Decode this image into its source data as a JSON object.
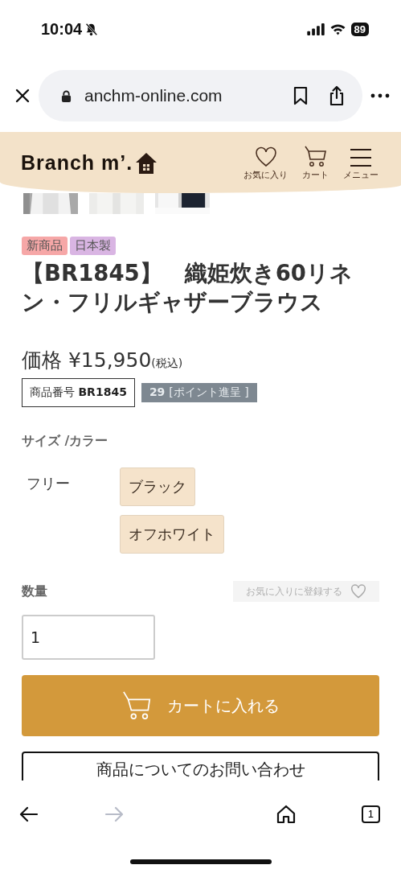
{
  "status_bar": {
    "time": "10:04",
    "battery": "89"
  },
  "browser": {
    "url": "anchm-online.com",
    "back_disabled": false,
    "forward_disabled": true,
    "tab_count": "1"
  },
  "site_header": {
    "logo": "Branch m’.",
    "nav": [
      {
        "kind": "heart",
        "label": "お気に入り"
      },
      {
        "kind": "cart",
        "label": "カート"
      },
      {
        "kind": "menu",
        "label": "メニュー"
      }
    ]
  },
  "product": {
    "tags": [
      {
        "label": "新商品",
        "color": "#f6a7a7"
      },
      {
        "label": "日本製",
        "color": "#d9b5e3"
      }
    ],
    "title": "【BR1845】　織姫炊き60リネン・フリルギャザーブラウス",
    "price_label": "価格",
    "price": "¥15,950",
    "tax_note": "(税込)",
    "code_label": "商品番号",
    "code": "BR1845",
    "points": "29",
    "points_label": "[ポイント進呈 ]"
  },
  "options": {
    "heading": "サイズ /カラー",
    "size": "フリー",
    "colors": [
      {
        "label": "ブラック"
      },
      {
        "label": "オフホワイト"
      }
    ]
  },
  "quantity": {
    "label": "数量",
    "value": "1",
    "favorite_button": "お気に入りに登録する"
  },
  "cart_button": "カートに入れる",
  "inquiry_button": "商品についてのお問い合わせ"
}
